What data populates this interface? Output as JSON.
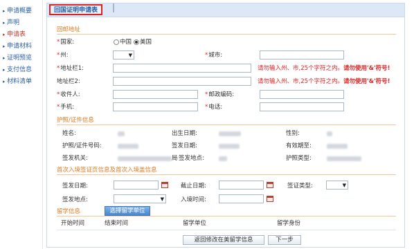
{
  "sidebar": {
    "items": [
      {
        "label": "申请概要"
      },
      {
        "label": "声明"
      },
      {
        "label": "申请表"
      },
      {
        "label": "申请材料"
      },
      {
        "label": "证明预览"
      },
      {
        "label": "支付信息"
      },
      {
        "label": "材料清单"
      }
    ]
  },
  "panel": {
    "title": "回国证明申请表"
  },
  "address": {
    "section_title": "回邮地址",
    "country_label": "国家:",
    "country_option_china": "中国",
    "country_option_usa": "美国",
    "state_label": "州:",
    "city_label": "城市:",
    "address1_label": "地址栏1:",
    "address2_label": "地址栏2:",
    "address_hint_main": "请勿输入州、市,25个字符之内。",
    "address_hint_bold": "请勿使用'&'符号!",
    "recipient_label": "收件人:",
    "postal_label": "邮政编码:",
    "mobile_label": "手机:",
    "phone_label": "电话:"
  },
  "passport": {
    "section_title": "护照/证件信息",
    "name_label": "姓名:",
    "dob_label": "出生日期:",
    "gender_label": "性别:",
    "number_label": "护照/证件号码:",
    "issue_date_label": "签发日期:",
    "expiry_label": "有效期至:",
    "authority_label": "签发机关:",
    "authority_value_suffix": "局",
    "issue_place_label": "签发地点:",
    "type_label": "护照类型:"
  },
  "visa": {
    "section_title": "首次入境签证页信息及首次入境盖信息",
    "issue_date_label": "签发日期:",
    "expiry_label": "截止日期:",
    "visa_type_label": "签证类型:",
    "issue_place_label": "签发地点:",
    "entry_time_label": "入境时间:"
  },
  "study": {
    "section_title": "留学信息",
    "select_button": "选择留学单位",
    "col_start": "开始时间",
    "col_end": "结束时间",
    "col_unit": "留学单位",
    "col_identity": "留学身份"
  },
  "footer": {
    "back_button": "返回修改在美留学信息",
    "next_button": "下一步"
  }
}
